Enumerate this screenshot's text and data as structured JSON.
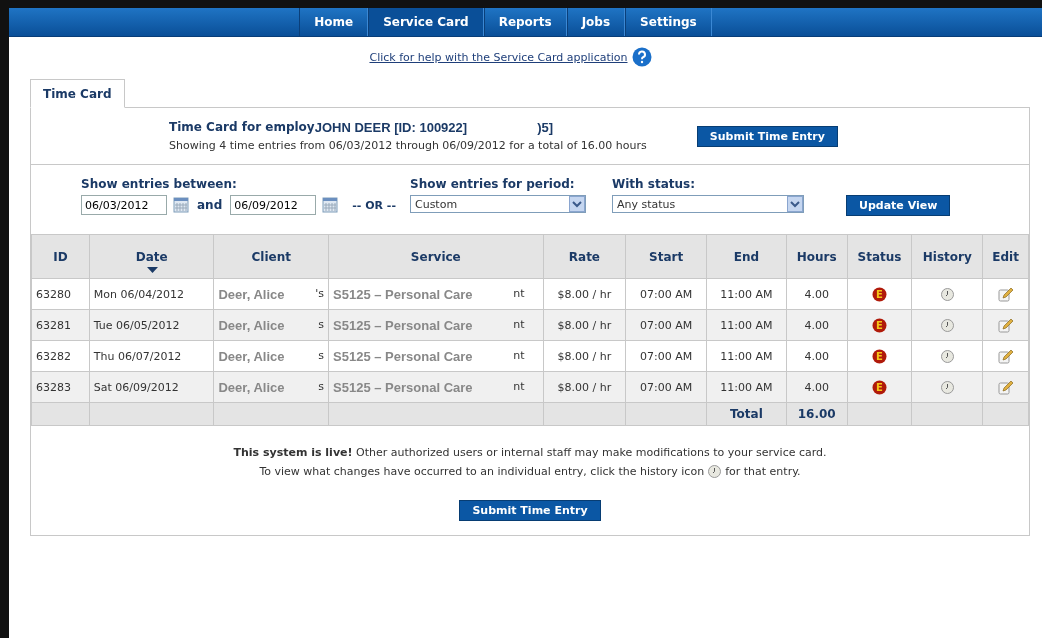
{
  "nav": [
    {
      "label": "Home",
      "selected": false
    },
    {
      "label": "Service Card",
      "selected": true
    },
    {
      "label": "Reports",
      "selected": false
    },
    {
      "label": "Jobs",
      "selected": false
    },
    {
      "label": "Settings",
      "selected": false
    }
  ],
  "help_link": "Click for help with the Service Card application",
  "tabs": [
    {
      "label": "Time Card",
      "selected": true
    }
  ],
  "heading": {
    "prefix": "Time Card for employ",
    "employee": "JOHN DEER  [ID: 100922]",
    "suffix": ")5]"
  },
  "summary": "Showing 4 time entries from 06/03/2012 through 06/09/2012 for a total of 16.00 hours",
  "submit_button": "Submit Time Entry",
  "filters": {
    "between_label": "Show entries between:",
    "date_from": "06/03/2012",
    "and_label": "and",
    "date_to": "06/09/2012",
    "or_label": "-- OR --",
    "period_label": "Show entries for period:",
    "period_value": "Custom",
    "status_label": "With status:",
    "status_value": "Any status",
    "update_button": "Update View"
  },
  "table": {
    "columns": [
      {
        "label": "ID",
        "sorted": false
      },
      {
        "label": "Date",
        "sorted": true
      },
      {
        "label": "Client",
        "sorted": false
      },
      {
        "label": "Service",
        "sorted": false
      },
      {
        "label": "Rate",
        "sorted": false
      },
      {
        "label": "Start",
        "sorted": false
      },
      {
        "label": "End",
        "sorted": false
      },
      {
        "label": "Hours",
        "sorted": false
      },
      {
        "label": "Status",
        "sorted": false
      },
      {
        "label": "History",
        "sorted": false
      },
      {
        "label": "Edit",
        "sorted": false
      }
    ],
    "rows": [
      {
        "id": "63280",
        "date": "Mon 06/04/2012",
        "client": "Deer, Alice",
        "client_tail": "'s",
        "service": "S5125 – Personal Care",
        "service_tail": "nt",
        "rate": "$8.00 / hr",
        "start": "07:00 AM",
        "end": "11:00 AM",
        "hours": "4.00",
        "status": "E"
      },
      {
        "id": "63281",
        "date": "Tue 06/05/2012",
        "client": "Deer, Alice",
        "client_tail": "s",
        "service": "S5125 – Personal Care",
        "service_tail": "nt",
        "rate": "$8.00 / hr",
        "start": "07:00 AM",
        "end": "11:00 AM",
        "hours": "4.00",
        "status": "E"
      },
      {
        "id": "63282",
        "date": "Thu 06/07/2012",
        "client": "Deer, Alice",
        "client_tail": "s",
        "service": "S5125 – Personal Care",
        "service_tail": "nt",
        "rate": "$8.00 / hr",
        "start": "07:00 AM",
        "end": "11:00 AM",
        "hours": "4.00",
        "status": "E"
      },
      {
        "id": "63283",
        "date": "Sat 06/09/2012",
        "client": "Deer, Alice",
        "client_tail": "s",
        "service": "S5125 – Personal Care",
        "service_tail": "nt",
        "rate": "$8.00 / hr",
        "start": "07:00 AM",
        "end": "11:00 AM",
        "hours": "4.00",
        "status": "E"
      }
    ],
    "total_label": "Total",
    "total_hours": "16.00"
  },
  "notice": {
    "line1": "**This system is live!** Other authorized users or internal staff may make modifications to your service card.",
    "line2_before": "To view what changes have occurred to an individual entry, click the history icon",
    "line2_after": "for that entry."
  },
  "bottom_button": "Submit Time Entry"
}
